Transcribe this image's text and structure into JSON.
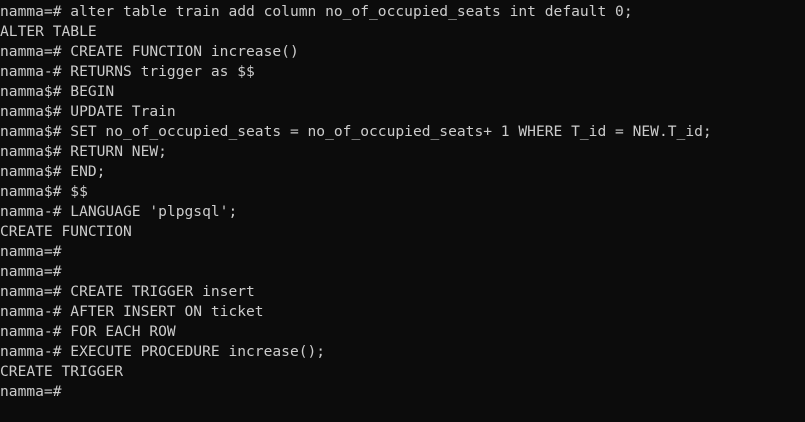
{
  "terminal": {
    "background": "#0c0c0c",
    "foreground": "#cccccc",
    "lines": [
      "namma=# alter table train add column no_of_occupied_seats int default 0;",
      "ALTER TABLE",
      "namma=# CREATE FUNCTION increase()",
      "namma-# RETURNS trigger as $$",
      "namma$# BEGIN",
      "namma$# UPDATE Train",
      "namma$# SET no_of_occupied_seats = no_of_occupied_seats+ 1 WHERE T_id = NEW.T_id;",
      "namma$# RETURN NEW;",
      "namma$# END;",
      "namma$# $$",
      "namma-# LANGUAGE 'plpgsql';",
      "CREATE FUNCTION",
      "namma=#",
      "namma=#",
      "namma=# CREATE TRIGGER insert",
      "namma-# AFTER INSERT ON ticket",
      "namma-# FOR EACH ROW",
      "namma-# EXECUTE PROCEDURE increase();",
      "CREATE TRIGGER",
      "namma=#"
    ]
  }
}
